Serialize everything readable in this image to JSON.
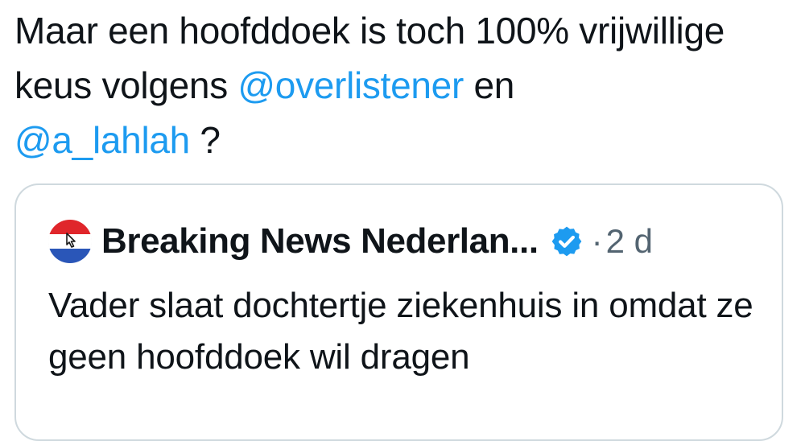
{
  "tweet": {
    "text_part1": "Maar een hoofddoek is toch 100% vrijwillige keus volgens ",
    "mention1": "@overlistener",
    "text_part2": " en ",
    "mention2": "@a_lahlah",
    "text_part3": " ?"
  },
  "quote": {
    "avatar_icon": "dutch-flag-cursor-avatar",
    "author_name": "Breaking News Nederlan...",
    "verified_icon": "verified-badge-icon",
    "separator": "·",
    "timestamp": "2 d",
    "body": "Vader slaat dochtertje ziekenhuis in omdat ze geen hoofddoek wil dragen"
  },
  "colors": {
    "mention": "#1d9bf0",
    "verified": "#1d9bf0",
    "flag_red": "#e0262b",
    "flag_white": "#ffffff",
    "flag_blue": "#2a56b8",
    "border": "#cfd9de",
    "muted": "#536471"
  }
}
